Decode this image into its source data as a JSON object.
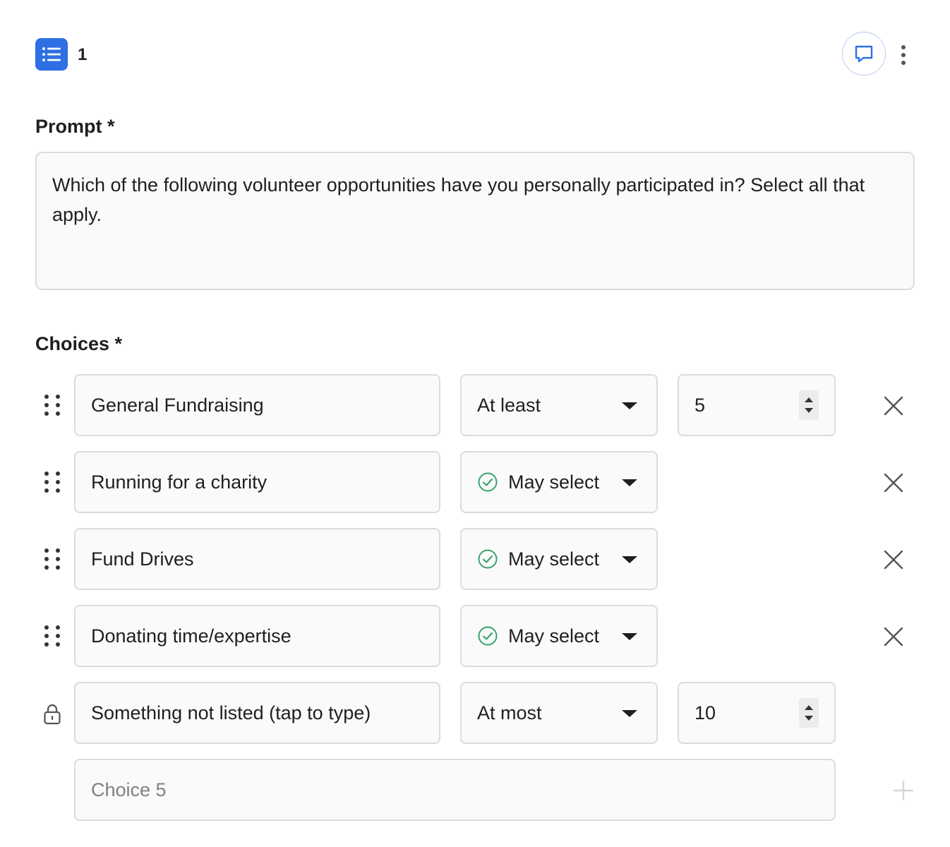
{
  "question": {
    "number": "1"
  },
  "prompt": {
    "label": "Prompt *",
    "text": "Which of the following volunteer opportunities have you personally participated in? Select all that apply."
  },
  "choices": {
    "label": "Choices *",
    "rows": [
      {
        "text": "General Fundraising",
        "rule": "At least",
        "count": "5"
      },
      {
        "text": "Running for a charity",
        "rule": "May select"
      },
      {
        "text": "Fund Drives",
        "rule": "May select"
      },
      {
        "text": "Donating time/expertise",
        "rule": "May select"
      },
      {
        "text": "Something not listed (tap to type)",
        "rule": "At most",
        "count": "10"
      }
    ],
    "new_choice_placeholder": "Choice 5"
  },
  "colors": {
    "accent": "#2f6fe4",
    "check": "#3aa36b"
  }
}
